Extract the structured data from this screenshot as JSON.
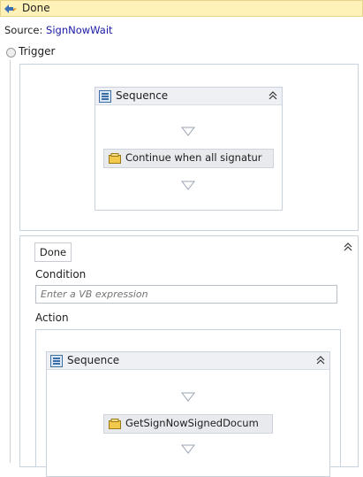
{
  "header": {
    "title": "Done"
  },
  "source": {
    "prefix": "Source:",
    "link": "SignNowWait"
  },
  "trigger": {
    "label": "Trigger",
    "sequence": {
      "label": "Sequence",
      "activity": "Continue when all signatur"
    }
  },
  "done_branch": {
    "tab_label": "Done",
    "condition_label": "Condition",
    "condition_placeholder": "Enter a VB expression",
    "action_label": "Action",
    "sequence": {
      "label": "Sequence",
      "activity": "GetSignNowSignedDocum"
    }
  },
  "colors": {
    "header_bg": "#fff2b8",
    "link": "#1a1aa6",
    "sequence_header": "#eef0f4",
    "activity_bg": "#e9eaee"
  }
}
